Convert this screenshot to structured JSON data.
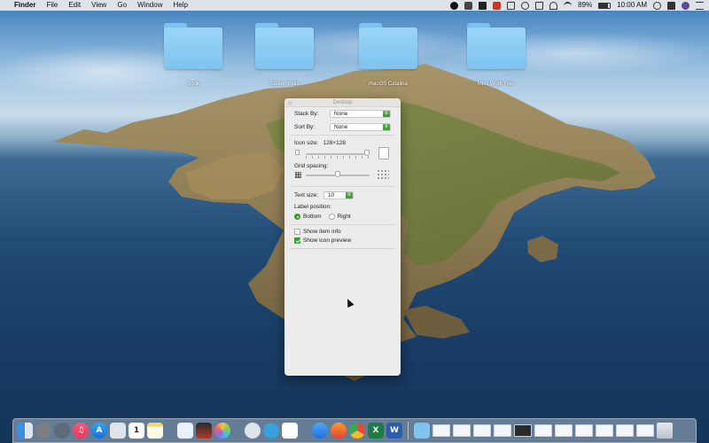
{
  "menubar": {
    "app_name": "Finder",
    "menus": [
      "File",
      "Edit",
      "View",
      "Go",
      "Window",
      "Help"
    ],
    "battery": "89%",
    "time": "10:00 AM"
  },
  "desktop": {
    "folders": [
      "Book",
      "Screenshots",
      "macOS Catalina",
      "Misc Work Files"
    ]
  },
  "panel": {
    "title": "Desktop",
    "stack_by_label": "Stack By:",
    "stack_by_value": "None",
    "sort_by_label": "Sort By:",
    "sort_by_value": "None",
    "icon_size_label": "Icon size:",
    "icon_size_value": "128×128",
    "grid_spacing_label": "Grid spacing:",
    "text_size_label": "Text size:",
    "text_size_value": "10",
    "label_position_label": "Label position:",
    "label_bottom": "Bottom",
    "label_right": "Right",
    "label_position_selected": "Bottom",
    "show_item_info_label": "Show item info",
    "show_item_info_checked": false,
    "show_icon_preview_label": "Show icon preview",
    "show_icon_preview_checked": true,
    "icon_size_level": 1.0,
    "grid_spacing_level": 0.5
  },
  "dock": {
    "apps": [
      "finder",
      "system-preferences",
      "launchpad",
      "music",
      "app-store",
      "preview",
      "calendar",
      "notes",
      "mail-send",
      "photo-booth",
      "photos",
      "messages",
      "telegram",
      "slack",
      "safari",
      "firefox",
      "chrome",
      "excel",
      "word"
    ],
    "calendar_day": "1"
  },
  "colors": {
    "accent_green": "#3a9a32",
    "folder_blue": "#7ec4ef"
  }
}
